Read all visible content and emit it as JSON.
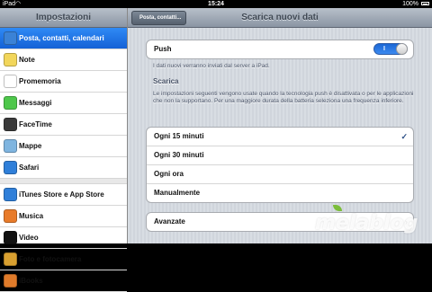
{
  "status_bar": {
    "carrier": "iPad",
    "time": "15:24",
    "battery": "100%"
  },
  "sidebar": {
    "title": "Impostazioni",
    "groups": [
      [
        {
          "label": "Posta, contatti, calendari",
          "icon": "mail-icon",
          "color": "#3b82d6",
          "active": true
        },
        {
          "label": "Note",
          "icon": "notes-icon",
          "color": "#f2d65b"
        },
        {
          "label": "Promemoria",
          "icon": "reminders-icon",
          "color": "#ffffff"
        },
        {
          "label": "Messaggi",
          "icon": "messages-icon",
          "color": "#4ec74b"
        },
        {
          "label": "FaceTime",
          "icon": "facetime-icon",
          "color": "#3a3a3a"
        },
        {
          "label": "Mappe",
          "icon": "maps-icon",
          "color": "#7fb5e0"
        },
        {
          "label": "Safari",
          "icon": "safari-icon",
          "color": "#2f7fd9"
        }
      ],
      [
        {
          "label": "iTunes Store e App Store",
          "icon": "appstore-icon",
          "color": "#2f7fd9"
        },
        {
          "label": "Musica",
          "icon": "music-icon",
          "color": "#e87b2a"
        },
        {
          "label": "Video",
          "icon": "video-icon",
          "color": "#111111"
        },
        {
          "label": "Foto e fotocamera",
          "icon": "photos-icon",
          "color": "#d9a030"
        },
        {
          "label": "iBooks",
          "icon": "ibooks-icon",
          "color": "#e07b2a"
        }
      ]
    ]
  },
  "detail": {
    "back_label": "Posta, contatti...",
    "title": "Scarica nuovi dati",
    "push": {
      "label": "Push",
      "on_label": "I"
    },
    "push_note": "I dati nuovi verranno inviati dal server a iPad.",
    "scarica_header": "Scarica",
    "scarica_note": "Le impostazioni seguenti vengono usate quando la tecnologia push è disattivata o per le applicazioni che non la supportano. Per una maggiore durata della batteria seleziona una frequenza inferiore.",
    "options": [
      {
        "label": "Ogni 15 minuti",
        "checked": true
      },
      {
        "label": "Ogni 30 minuti",
        "checked": false
      },
      {
        "label": "Ogni ora",
        "checked": false
      },
      {
        "label": "Manualmente",
        "checked": false
      }
    ],
    "advanced_label": "Avanzate",
    "check_mark": "✓"
  },
  "watermark": {
    "text": "melablog"
  }
}
